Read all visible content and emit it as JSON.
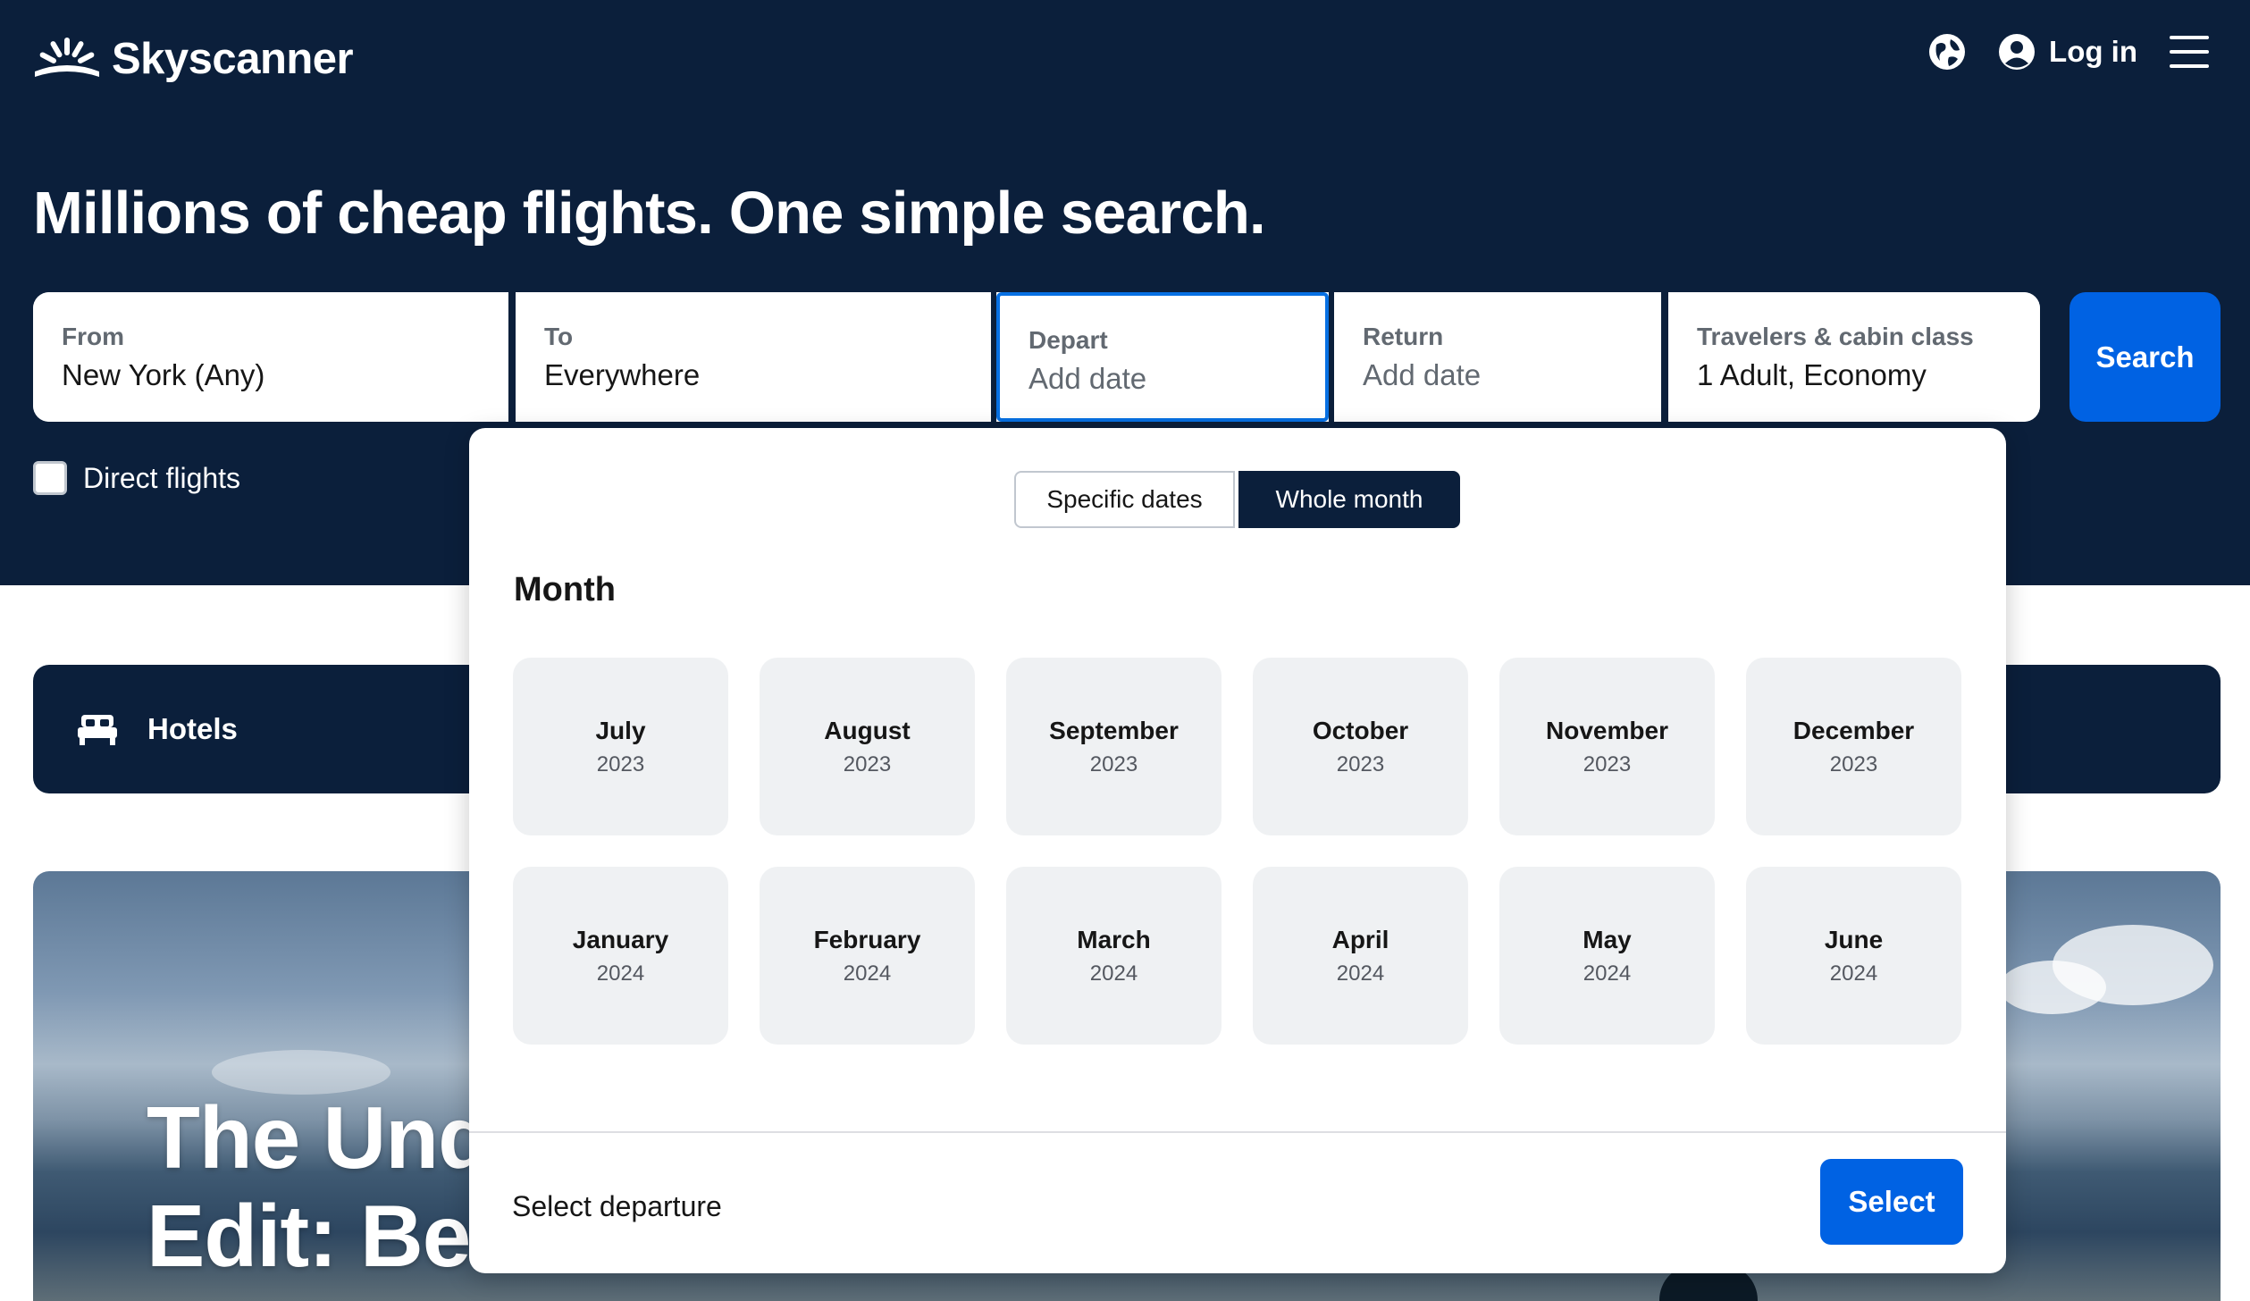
{
  "header": {
    "brand": "Skyscanner",
    "login_label": "Log in",
    "icons": [
      "logo-sun-icon",
      "globe-icon",
      "user-icon",
      "menu-icon"
    ]
  },
  "hero": {
    "headline": "Millions of cheap flights. One simple search."
  },
  "search": {
    "from": {
      "label": "From",
      "value": "New York (Any)"
    },
    "to": {
      "label": "To",
      "value": "Everywhere"
    },
    "depart": {
      "label": "Depart",
      "placeholder": "Add date"
    },
    "return": {
      "label": "Return",
      "placeholder": "Add date"
    },
    "travelers": {
      "label": "Travelers & cabin class",
      "value": "1 Adult, Economy"
    },
    "button_label": "Search",
    "direct_flights_label": "Direct flights",
    "direct_flights_checked": false
  },
  "hotels": {
    "label": "Hotels",
    "icon": "bed-icon"
  },
  "banner": {
    "line1": "The Und",
    "line2": "Edit: Bea"
  },
  "datepicker": {
    "tabs": [
      {
        "label": "Specific dates",
        "active": false
      },
      {
        "label": "Whole month",
        "active": true
      }
    ],
    "section_title": "Month",
    "months": [
      {
        "month": "July",
        "year": "2023"
      },
      {
        "month": "August",
        "year": "2023"
      },
      {
        "month": "September",
        "year": "2023"
      },
      {
        "month": "October",
        "year": "2023"
      },
      {
        "month": "November",
        "year": "2023"
      },
      {
        "month": "December",
        "year": "2023"
      },
      {
        "month": "January",
        "year": "2024"
      },
      {
        "month": "February",
        "year": "2024"
      },
      {
        "month": "March",
        "year": "2024"
      },
      {
        "month": "April",
        "year": "2024"
      },
      {
        "month": "May",
        "year": "2024"
      },
      {
        "month": "June",
        "year": "2024"
      }
    ],
    "footer_text": "Select departure",
    "select_label": "Select"
  },
  "colors": {
    "navy": "#0b1f3b",
    "blue": "#0062e3",
    "focus": "#0770e3",
    "cell": "#eff1f3"
  }
}
